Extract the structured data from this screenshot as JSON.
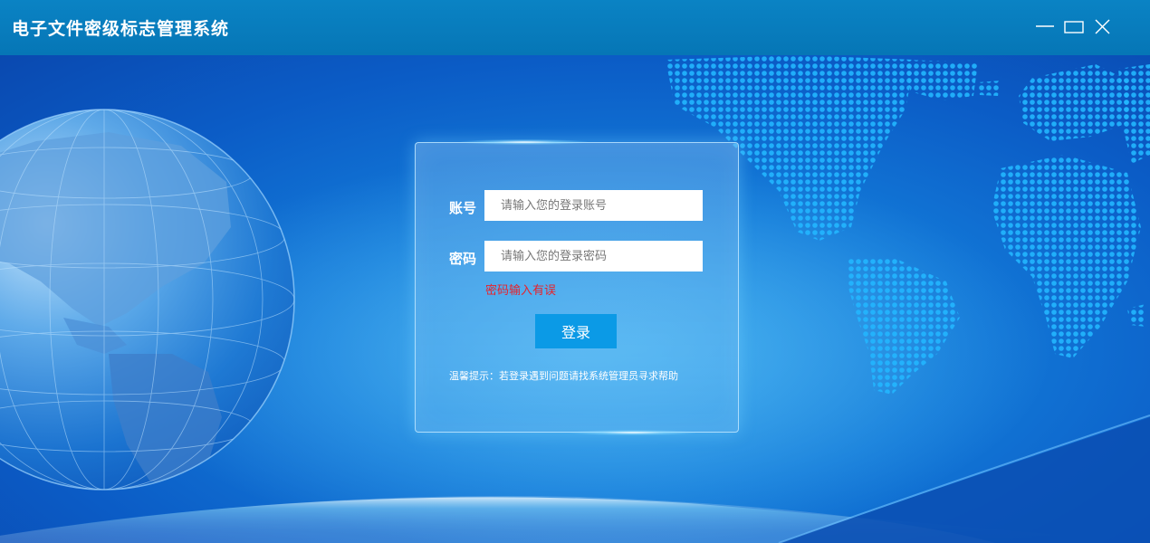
{
  "window": {
    "title": "电子文件密级标志管理系统",
    "controls": {
      "minimize_icon": "minimize-icon",
      "maximize_icon": "maximize-icon",
      "close_icon": "close-icon"
    }
  },
  "login": {
    "account": {
      "label": "账号",
      "placeholder": "请输入您的登录账号",
      "value": ""
    },
    "password": {
      "label": "密码",
      "placeholder": "请输入您的登录密码",
      "value": ""
    },
    "error_message": "密码输入有误",
    "submit_label": "登录",
    "tip": "温馨提示：若登录遇到问题请找系统管理员寻求帮助"
  },
  "theme": {
    "titlebar": "#0a7fc0",
    "background": "#0b5cc6",
    "button": "#0b9ae6",
    "error": "#e8222a"
  }
}
